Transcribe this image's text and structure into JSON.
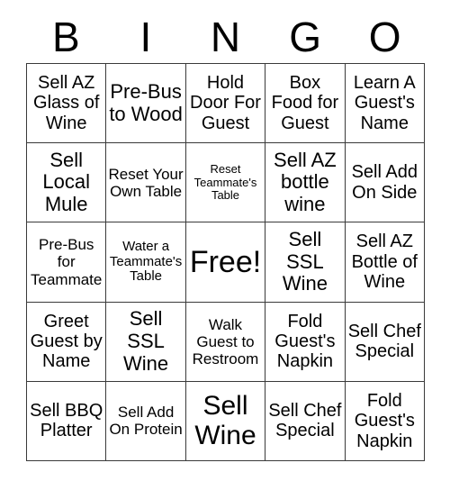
{
  "header": {
    "letters": [
      "B",
      "I",
      "N",
      "G",
      "O"
    ]
  },
  "grid": {
    "rows": 5,
    "columns": 5,
    "border_color": "#3a3a3a",
    "background_color": "#ffffff",
    "text_color": "#000000",
    "cells": [
      {
        "text": "Sell AZ Glass of Wine",
        "size": "lg"
      },
      {
        "text": "Pre-Bus to Wood",
        "size": "xl"
      },
      {
        "text": "Hold Door For Guest",
        "size": "lg"
      },
      {
        "text": "Box Food for Guest",
        "size": "lg"
      },
      {
        "text": "Learn A Guest's Name",
        "size": "lg"
      },
      {
        "text": "Sell Local Mule",
        "size": "xl"
      },
      {
        "text": "Reset Your Own Table",
        "size": "md"
      },
      {
        "text": "Reset Teammate's Table",
        "size": "xs"
      },
      {
        "text": "Sell AZ bottle wine",
        "size": "xl"
      },
      {
        "text": "Sell Add On Side",
        "size": "lg"
      },
      {
        "text": "Pre-Bus for Teammate",
        "size": "md"
      },
      {
        "text": "Water a Teammate's Table",
        "size": "sm"
      },
      {
        "text": "Free!",
        "size": "free"
      },
      {
        "text": "Sell SSL Wine",
        "size": "xl"
      },
      {
        "text": "Sell AZ Bottle of Wine",
        "size": "lg"
      },
      {
        "text": "Greet Guest by Name",
        "size": "lg"
      },
      {
        "text": "Sell SSL Wine",
        "size": "xl"
      },
      {
        "text": "Walk Guest to Restroom",
        "size": "md"
      },
      {
        "text": "Fold Guest's Napkin",
        "size": "lg"
      },
      {
        "text": "Sell Chef Special",
        "size": "lg"
      },
      {
        "text": "Sell BBQ Platter",
        "size": "lg"
      },
      {
        "text": "Sell Add On Protein",
        "size": "md"
      },
      {
        "text": "Sell Wine",
        "size": "xxl"
      },
      {
        "text": "Sell Chef Special",
        "size": "lg"
      },
      {
        "text": "Fold Guest's Napkin",
        "size": "lg"
      }
    ]
  }
}
